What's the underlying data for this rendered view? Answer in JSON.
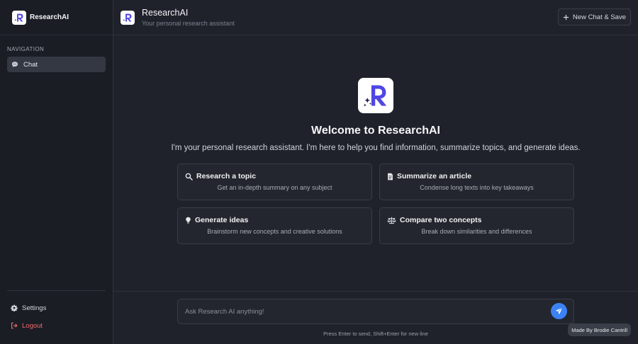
{
  "app": {
    "name": "ResearchAI",
    "subtitle": "Your personal research assistant"
  },
  "sidebar": {
    "nav_heading": "NAVIGATION",
    "items": [
      {
        "label": "Chat",
        "icon": "chat-bubble-icon",
        "active": true
      }
    ],
    "bottom": [
      {
        "label": "Settings",
        "icon": "gear-icon"
      },
      {
        "label": "Logout",
        "icon": "logout-icon"
      }
    ]
  },
  "header": {
    "new_chat_label": "New Chat & Save"
  },
  "welcome": {
    "title": "Welcome to ResearchAI",
    "subtitle": "I'm your personal research assistant. I'm here to help you find information, summarize topics, and generate ideas."
  },
  "suggestions": [
    {
      "title": "Research a topic",
      "description": "Get an in-depth summary on any subject",
      "icon": "search-icon"
    },
    {
      "title": "Summarize an article",
      "description": "Condense long texts into key takeaways",
      "icon": "document-icon"
    },
    {
      "title": "Generate ideas",
      "description": "Brainstorm new concepts and creative solutions",
      "icon": "lightbulb-icon"
    },
    {
      "title": "Compare two concepts",
      "description": "Break down similarities and differences",
      "icon": "scale-icon"
    }
  ],
  "composer": {
    "placeholder": "Ask Research AI anything!",
    "value": "",
    "hint": "Press Enter to send, Shift+Enter for new line"
  },
  "footer": {
    "made_by": "Made By Brodie Cantrill"
  },
  "colors": {
    "accent": "#3b82f6",
    "logo_primary": "#4f46e5",
    "logout": "#f06a6a",
    "background": "#1f222b"
  }
}
